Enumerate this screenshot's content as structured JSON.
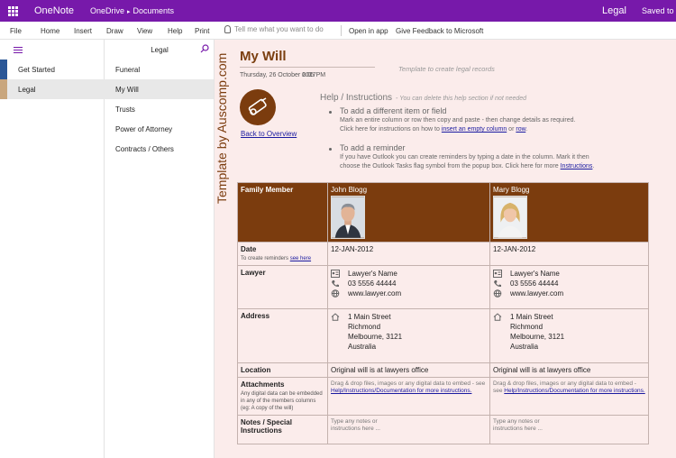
{
  "titlebar": {
    "app": "OneNote",
    "location": "OneDrive",
    "separator": "▸",
    "folder": "Documents",
    "notebook": "Legal",
    "status": "Saved to"
  },
  "ribbon": {
    "tabs": [
      "File",
      "Home",
      "Insert",
      "Draw",
      "View",
      "Help",
      "Print"
    ],
    "tellme": "Tell me what you want to do",
    "open_in_app": "Open in app",
    "feedback": "Give Feedback to Microsoft"
  },
  "sections": {
    "items": [
      {
        "label": "Get Started",
        "color": "#2b5797"
      },
      {
        "label": "Legal",
        "color": "#c9a67d"
      }
    ]
  },
  "pages": {
    "title": "Legal",
    "items": [
      "Funeral",
      "My Will",
      "Trusts",
      "Power of Attorney",
      "Contracts / Others"
    ]
  },
  "page": {
    "vertical_text": "Template by Auscomp.com",
    "title": "My Will",
    "date": "Thursday, 26 October 2017",
    "time": "6:05 PM",
    "template_note": "Template to create legal records",
    "back_link": "Back to Overview",
    "help": {
      "title": "Help / Instructions",
      "subtitle": "- You can delete this help section if not needed",
      "item1_head": "To add a different item or field",
      "item1_line1": "Mark an entire column or row then copy and paste - then change details as required.",
      "item1_line2_pre": "Click here for instructions on how to",
      "item1_link1": "insert an empty column",
      "item1_or": "or",
      "item1_link2": "row",
      "item1_end": ".",
      "item2_head": "To add a reminder",
      "item2_line1": "If you have Outlook you can create reminders by typing a date in the column. Mark it then",
      "item2_line2_pre": "choose the Outlook Tasks flag symbol from the popup box. Click here for more",
      "item2_link": "Instructions",
      "item2_end": "."
    },
    "table": {
      "header": {
        "label": "Family Member",
        "person1": "John Blogg",
        "person2": "Mary Blogg"
      },
      "date": {
        "label": "Date",
        "note_pre": "To create reminders",
        "note_link": "see here",
        "v1": "12-JAN-2012",
        "v2": "12-JAN-2012"
      },
      "lawyer": {
        "label": "Lawyer",
        "name": "Lawyer's Name",
        "phone": "03 5556 44444",
        "web": "www.lawyer.com"
      },
      "address": {
        "label": "Address",
        "line1": "1 Main Street",
        "line2": "Richmond",
        "line3": "Melbourne, 3121",
        "line4": "Australia"
      },
      "location": {
        "label": "Location",
        "v1": "Original will is at lawyers office",
        "v2": "Original will is at lawyers office"
      },
      "attachments": {
        "label": "Attachments",
        "note": "Any digital data can be embedded in any of the members columns (eg: A copy of the will)",
        "c1_pre": "Drag & drop files, images or any digital data to embed - see",
        "c1_link": "Help/Instructions/Documentation for more instructions.",
        "c2_pre": "Drag & drop files, images or any digital data to embed - see",
        "c2_link": "Help/Instructions/Documentation for more instructions."
      },
      "notes": {
        "label": "Notes / Special Instructions",
        "v1": "Type any notes or instructions here ...",
        "v2": "Type any notes or instructions here ..."
      }
    }
  },
  "colors": {
    "accent": "#7719aa",
    "brown": "#7b3c0e",
    "canvas": "#fbeceb",
    "link": "#1a1aa0"
  }
}
